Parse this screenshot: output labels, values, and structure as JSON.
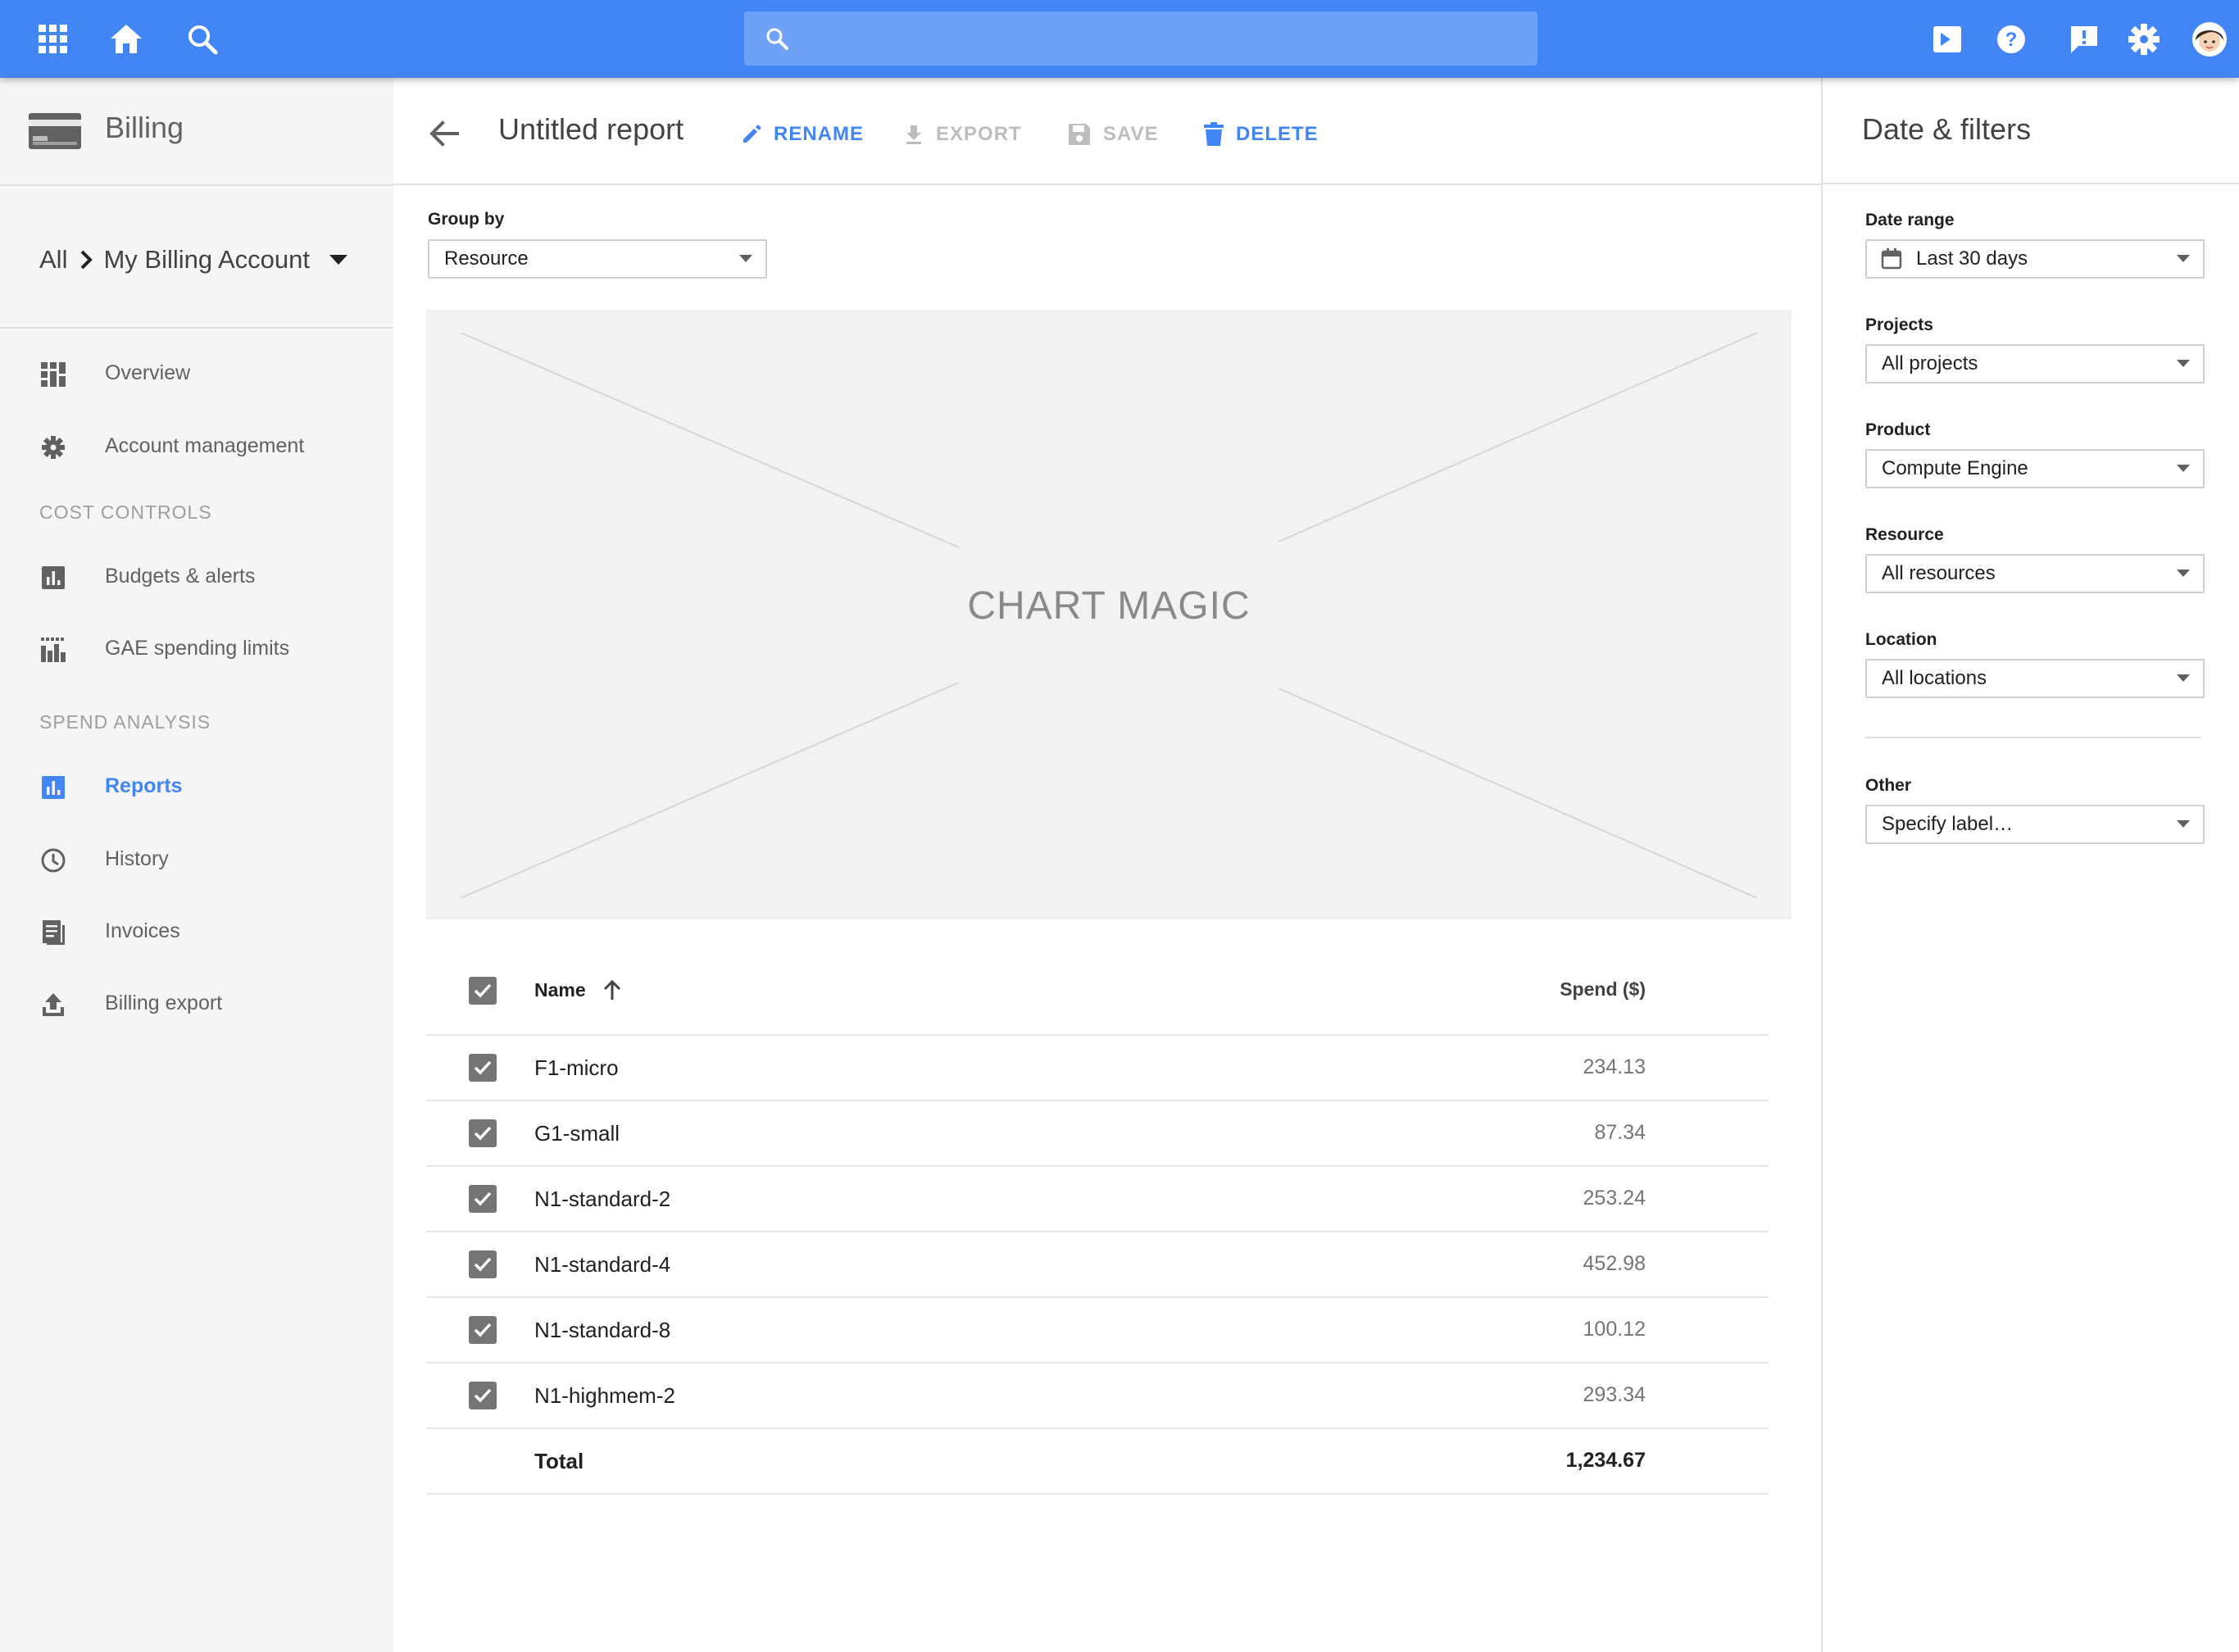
{
  "topbar": {
    "icons": [
      "apps-grid-icon",
      "home-icon",
      "search-icon",
      "cloud-shell-icon",
      "help-icon",
      "feedback-icon",
      "settings-icon",
      "user-avatar"
    ],
    "search_placeholder": "",
    "color": "#4285f4"
  },
  "sidebar": {
    "title": "Billing",
    "breadcrumb_root": "All",
    "account_name": "My Billing Account",
    "items_top": [
      {
        "label": "Overview",
        "icon": "dashboard-icon"
      },
      {
        "label": "Account management",
        "icon": "gear-icon"
      }
    ],
    "section_cost": "COST CONTROLS",
    "items_cost": [
      {
        "label": "Budgets & alerts",
        "icon": "bar-chart-icon"
      },
      {
        "label": "GAE spending limits",
        "icon": "limits-icon"
      }
    ],
    "section_spend": "SPEND ANALYSIS",
    "items_spend": [
      {
        "label": "Reports",
        "icon": "reports-icon",
        "active": true
      },
      {
        "label": "History",
        "icon": "clock-icon"
      },
      {
        "label": "Invoices",
        "icon": "invoice-icon"
      },
      {
        "label": "Billing export",
        "icon": "upload-icon"
      }
    ],
    "active_color": "#4285f4"
  },
  "header": {
    "title": "Untitled report",
    "rename": "RENAME",
    "export": "EXPORT",
    "save": "SAVE",
    "delete": "DELETE"
  },
  "groupby": {
    "label": "Group by",
    "value": "Resource"
  },
  "chart": {
    "placeholder_text": "CHART MAGIC"
  },
  "table": {
    "col_name": "Name",
    "col_spend": "Spend ($)",
    "rows": [
      {
        "name": "F1-micro",
        "spend": "234.13",
        "checked": true
      },
      {
        "name": "G1-small",
        "spend": "87.34",
        "checked": true
      },
      {
        "name": "N1-standard-2",
        "spend": "253.24",
        "checked": true
      },
      {
        "name": "N1-standard-4",
        "spend": "452.98",
        "checked": true
      },
      {
        "name": "N1-standard-8",
        "spend": "100.12",
        "checked": true
      },
      {
        "name": "N1-highmem-2",
        "spend": "293.34",
        "checked": true
      }
    ],
    "total_label": "Total",
    "total_value": "1,234.67"
  },
  "filters": {
    "title": "Date & filters",
    "date_range_label": "Date range",
    "date_range_value": "Last 30 days",
    "projects_label": "Projects",
    "projects_value": "All projects",
    "product_label": "Product",
    "product_value": "Compute Engine",
    "resource_label": "Resource",
    "resource_value": "All resources",
    "location_label": "Location",
    "location_value": "All locations",
    "other_label": "Other",
    "other_value": "Specify label…"
  }
}
